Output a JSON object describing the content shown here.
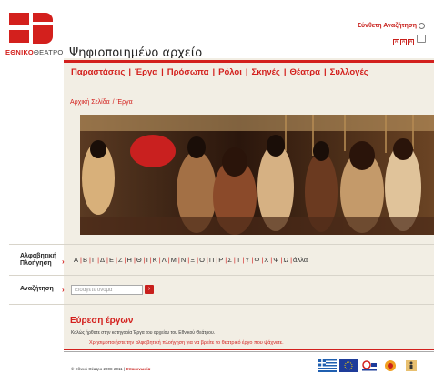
{
  "brand": {
    "logo_part1": "ΕΘΝΙΚΟ",
    "logo_part2": "ΘΕΑΤΡΟ"
  },
  "header": {
    "title": "Ψηφιοποιημένο αρχείο",
    "advanced_search": "Σύνθετη Αναζήτηση",
    "tools": [
      "A",
      "A",
      "A"
    ]
  },
  "nav": {
    "items": [
      "Παραστάσεις",
      "Έργα",
      "Πρόσωπα",
      "Ρόλοι",
      "Σκηνές",
      "Θέατρα",
      "Συλλογές"
    ]
  },
  "breadcrumb": {
    "home": "Αρχική Σελίδα",
    "sep": "/",
    "current": "Έργα"
  },
  "alpha_nav": {
    "label_line1": "Αλφαβητική",
    "label_line2": "Πλοήγηση",
    "letters": [
      "Α",
      "Β",
      "Γ",
      "Δ",
      "Ε",
      "Ζ",
      "Η",
      "Θ",
      "Ι",
      "Κ",
      "Λ",
      "Μ",
      "Ν",
      "Ξ",
      "Ο",
      "Π",
      "Ρ",
      "Σ",
      "Τ",
      "Υ",
      "Φ",
      "Χ",
      "Ψ",
      "Ω"
    ],
    "other": "άλλα"
  },
  "search": {
    "label": "Αναζήτηση",
    "placeholder": "Εισάγετε όνομα"
  },
  "section": {
    "title": "Εύρεση έργων",
    "desc1": "Καλώς ήρθατε στην κατηγορία Έργα του αρχείου του Εθνικού Θεάτρου.",
    "desc2": "Χρησιμοποιήστε την αλφαβητική πλοήγηση για να βρείτε το θεατρικό έργο που ψάχνετε."
  },
  "footer": {
    "copyright": "© Εθνικό Θέατρο 2008-2011",
    "sep": "|",
    "contact": "Επικοινωνία"
  },
  "colors": {
    "accent": "#d3201d",
    "content_bg": "#f2eee4"
  }
}
